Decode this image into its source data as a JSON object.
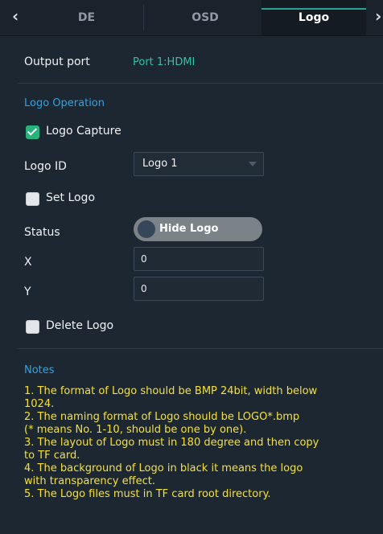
{
  "tabs": [
    "DE",
    "OSD",
    "Logo"
  ],
  "active_tab": "Logo",
  "output_port": {
    "label": "Output port",
    "value": "Port 1:HDMI"
  },
  "logo_operation": {
    "title": "Logo Operation",
    "capture_label": "Logo Capture",
    "capture_checked": true,
    "logo_id_label": "Logo ID",
    "logo_id_value": "Logo 1",
    "set_logo_label": "Set Logo",
    "set_logo_checked": false,
    "status_label": "Status",
    "status_value": "Hide Logo",
    "x_label": "X",
    "x_value": "0",
    "y_label": "Y",
    "y_value": "0",
    "delete_label": "Delete Logo",
    "delete_checked": false
  },
  "notes": {
    "title": "Notes",
    "lines": [
      "1. The format of Logo should be BMP 24bit, width below",
      "1024.",
      "2. The naming format of Logo should be LOGO*.bmp",
      "(* means No. 1-10,  should be one by one).",
      "3. The layout of Logo must in 180 degree and then copy",
      "to TF card.",
      "4. The background of Logo in black it means the logo",
      "with transparency effect.",
      "5. The Logo files must in TF card root directory."
    ]
  },
  "colors": {
    "accent_teal": "#2ec4a8",
    "section_blue": "#2aa5e8",
    "notes_yellow": "#f4e03a",
    "check_green": "#29b37c"
  }
}
